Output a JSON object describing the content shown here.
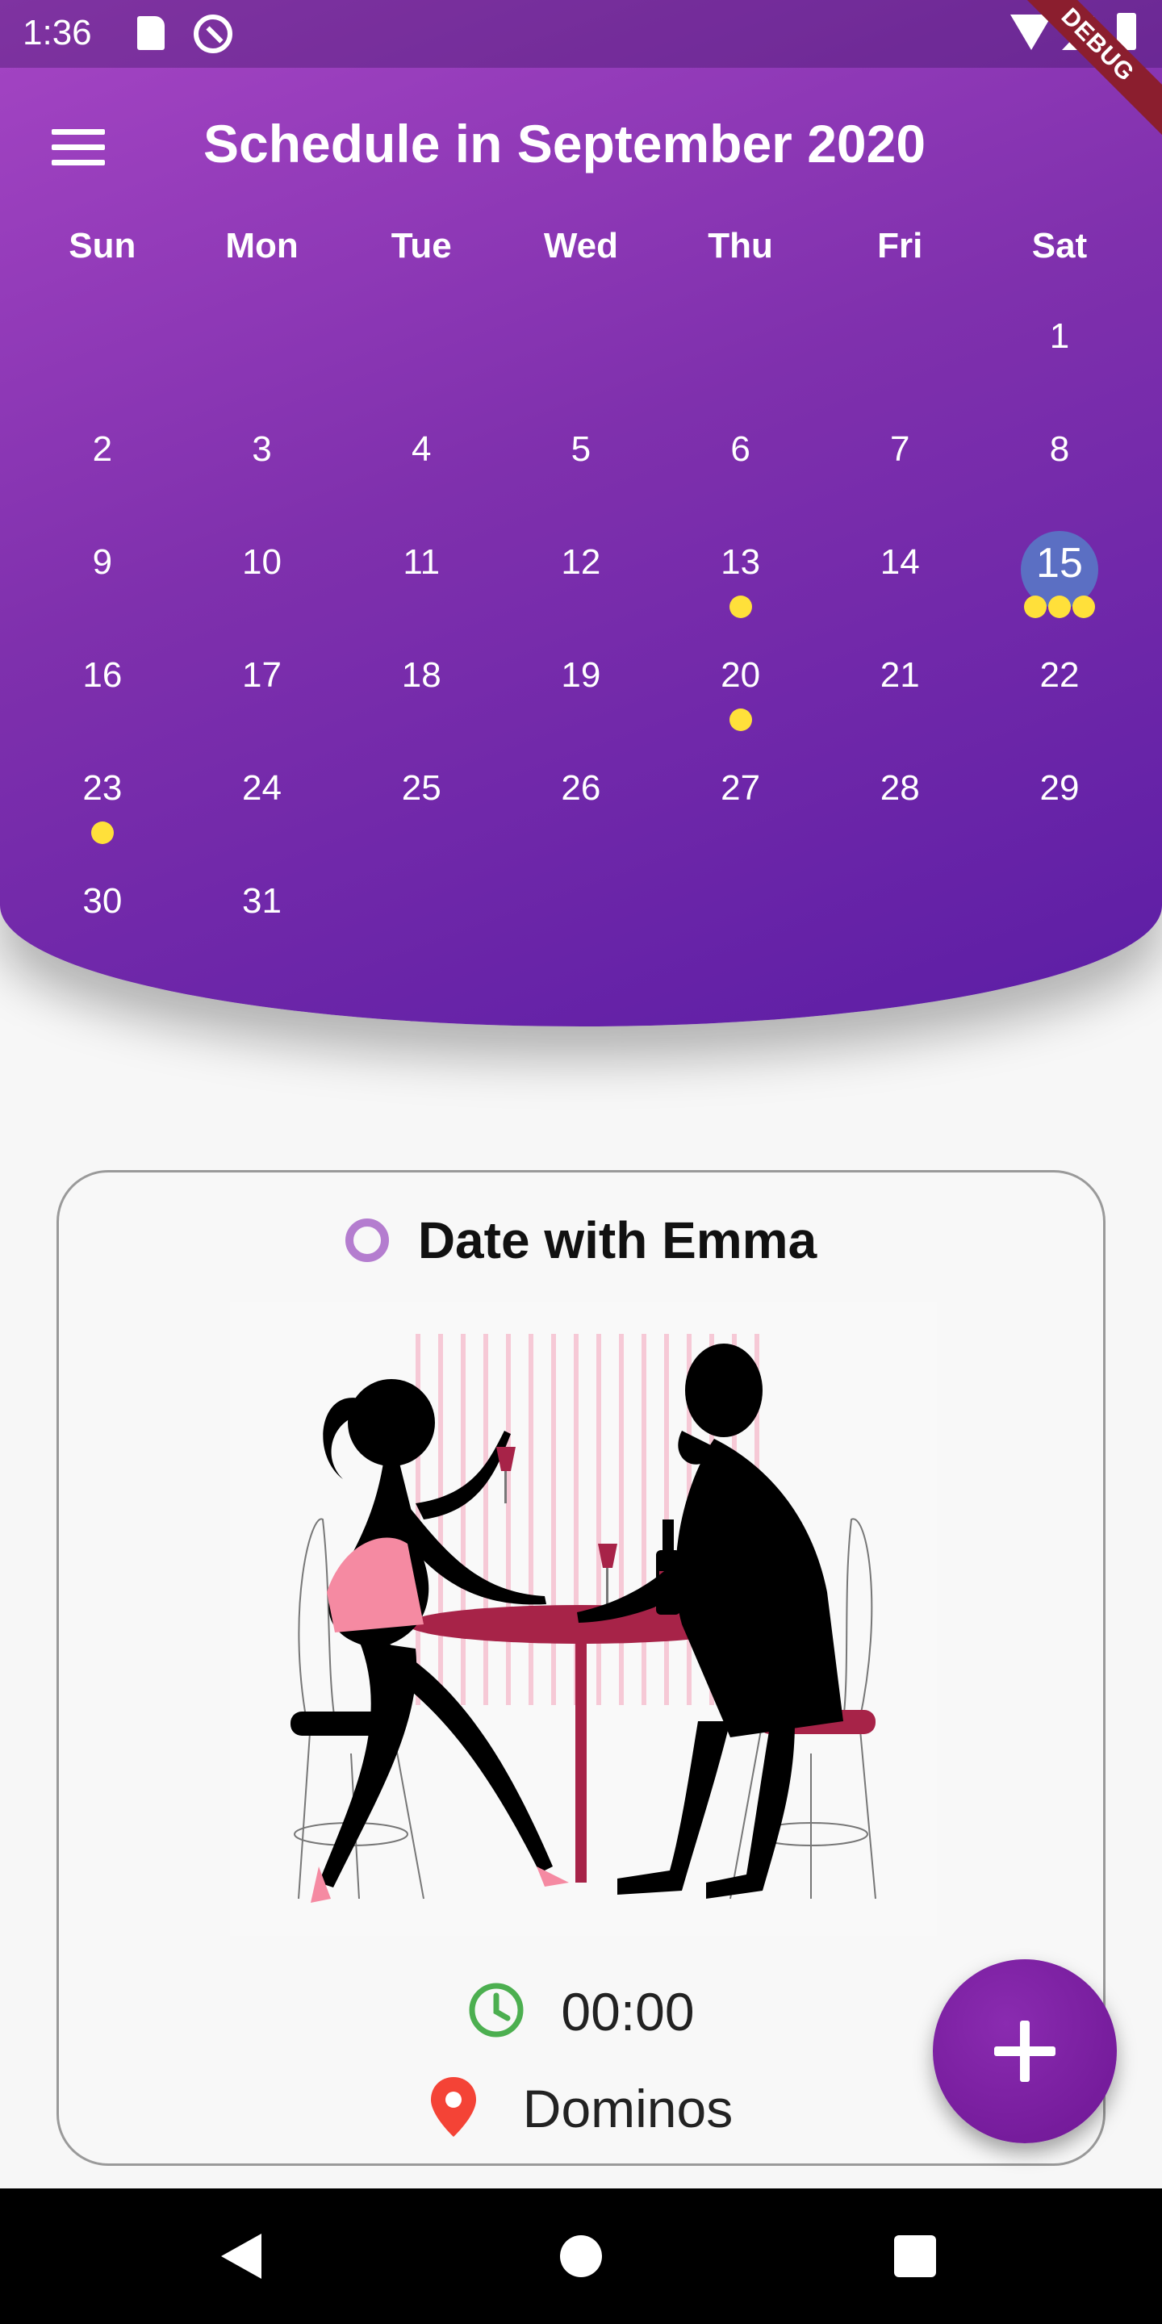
{
  "status_bar": {
    "time": "1:36",
    "debug_label": "DEBUG"
  },
  "header": {
    "title": "Schedule in September 2020"
  },
  "calendar": {
    "weekdays": [
      "Sun",
      "Mon",
      "Tue",
      "Wed",
      "Thu",
      "Fri",
      "Sat"
    ],
    "leading_blanks": 6,
    "days": [
      {
        "d": "1",
        "dots": 0
      },
      {
        "d": "2",
        "dots": 0
      },
      {
        "d": "3",
        "dots": 0
      },
      {
        "d": "4",
        "dots": 0
      },
      {
        "d": "5",
        "dots": 0
      },
      {
        "d": "6",
        "dots": 0
      },
      {
        "d": "7",
        "dots": 0
      },
      {
        "d": "8",
        "dots": 0
      },
      {
        "d": "9",
        "dots": 0
      },
      {
        "d": "10",
        "dots": 0
      },
      {
        "d": "11",
        "dots": 0
      },
      {
        "d": "12",
        "dots": 0
      },
      {
        "d": "13",
        "dots": 1
      },
      {
        "d": "14",
        "dots": 0
      },
      {
        "d": "15",
        "dots": 3,
        "selected": true
      },
      {
        "d": "16",
        "dots": 0
      },
      {
        "d": "17",
        "dots": 0
      },
      {
        "d": "18",
        "dots": 0
      },
      {
        "d": "19",
        "dots": 0
      },
      {
        "d": "20",
        "dots": 1
      },
      {
        "d": "21",
        "dots": 0
      },
      {
        "d": "22",
        "dots": 0
      },
      {
        "d": "23",
        "dots": 1
      },
      {
        "d": "24",
        "dots": 0
      },
      {
        "d": "25",
        "dots": 0
      },
      {
        "d": "26",
        "dots": 0
      },
      {
        "d": "27",
        "dots": 0
      },
      {
        "d": "28",
        "dots": 0
      },
      {
        "d": "29",
        "dots": 0
      },
      {
        "d": "30",
        "dots": 0
      },
      {
        "d": "31",
        "dots": 0
      }
    ]
  },
  "event": {
    "title": "Date with Emma",
    "time": "00:00",
    "location": "Dominos"
  },
  "colors": {
    "accent": "#7f30ad",
    "selected_day": "#5b6fc3",
    "event_dot": "#ffe03a",
    "clock_icon": "#4caf50",
    "pin_icon": "#f44336"
  }
}
